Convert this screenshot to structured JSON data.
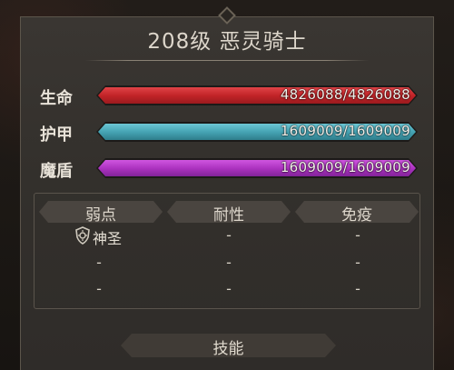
{
  "header": {
    "title": "208级  恶灵骑士"
  },
  "stats": {
    "hp": {
      "label": "生命",
      "value": "4826088/4826088",
      "fraction": 1.0,
      "color": "#c8262a"
    },
    "armor": {
      "label": "护甲",
      "value": "1609009/1609009",
      "fraction": 1.0,
      "color": "#4aa9b8"
    },
    "barrier": {
      "label": "魔盾",
      "value": "1609009/1609009",
      "fraction": 1.0,
      "color": "#b235c4"
    }
  },
  "traits": {
    "headers": {
      "weakness": "弱点",
      "resistance": "耐性",
      "immunity": "免疫"
    },
    "weakness": {
      "row1": "神圣",
      "row2": "-",
      "row3": "-"
    },
    "resistance": {
      "row1": "-",
      "row2": "-",
      "row3": "-"
    },
    "immunity": {
      "row1": "-",
      "row2": "-",
      "row3": "-"
    },
    "icons": {
      "holy": "holy-shield-icon"
    }
  },
  "actions": {
    "skills_label": "技能"
  }
}
